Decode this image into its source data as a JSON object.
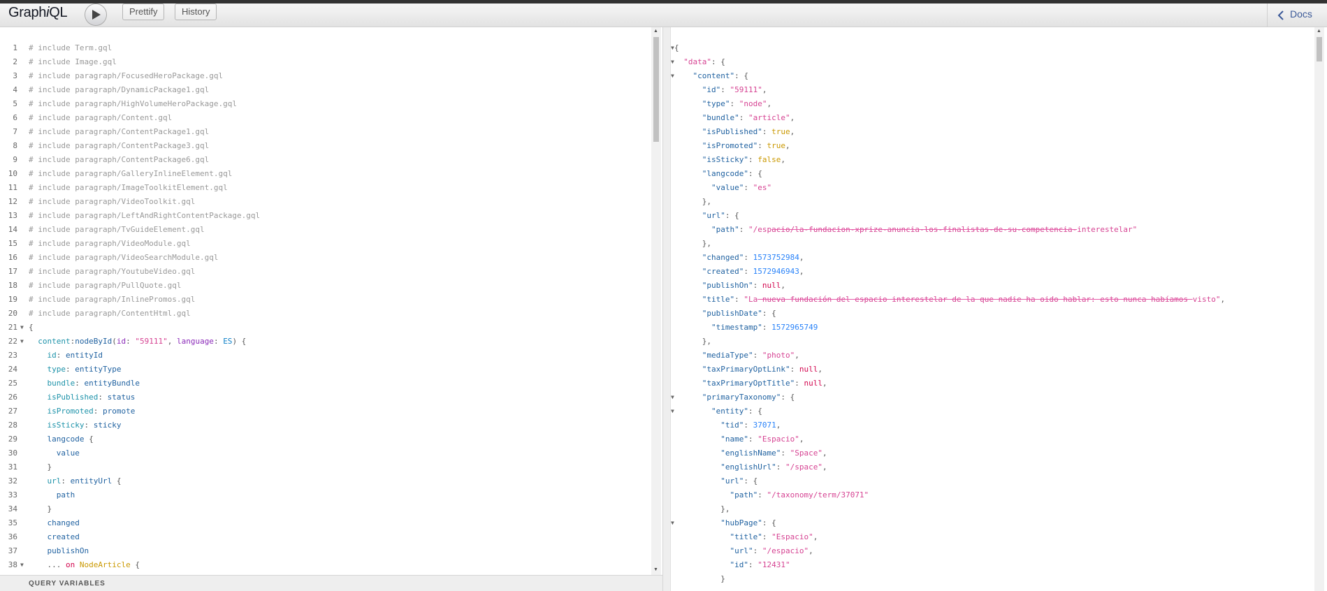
{
  "toolbar": {
    "title_prefix": "Graph",
    "title_italic": "i",
    "title_suffix": "QL",
    "run_label": "Execute Query",
    "prettify_label": "Prettify",
    "history_label": "History",
    "docs_label": "Docs"
  },
  "query_variables_label": "QUERY VARIABLES",
  "editor_lines": [
    {
      "n": "1",
      "fold": "",
      "tokens": [
        [
          "c-comment",
          "# include Term.gql"
        ]
      ]
    },
    {
      "n": "2",
      "fold": "",
      "tokens": [
        [
          "c-comment",
          "# include Image.gql"
        ]
      ]
    },
    {
      "n": "3",
      "fold": "",
      "tokens": [
        [
          "c-comment",
          "# include paragraph/FocusedHeroPackage.gql"
        ]
      ]
    },
    {
      "n": "4",
      "fold": "",
      "tokens": [
        [
          "c-comment",
          "# include paragraph/DynamicPackage1.gql"
        ]
      ]
    },
    {
      "n": "5",
      "fold": "",
      "tokens": [
        [
          "c-comment",
          "# include paragraph/HighVolumeHeroPackage.gql"
        ]
      ]
    },
    {
      "n": "6",
      "fold": "",
      "tokens": [
        [
          "c-comment",
          "# include paragraph/Content.gql"
        ]
      ]
    },
    {
      "n": "7",
      "fold": "",
      "tokens": [
        [
          "c-comment",
          "# include paragraph/ContentPackage1.gql"
        ]
      ]
    },
    {
      "n": "8",
      "fold": "",
      "tokens": [
        [
          "c-comment",
          "# include paragraph/ContentPackage3.gql"
        ]
      ]
    },
    {
      "n": "9",
      "fold": "",
      "tokens": [
        [
          "c-comment",
          "# include paragraph/ContentPackage6.gql"
        ]
      ]
    },
    {
      "n": "10",
      "fold": "",
      "tokens": [
        [
          "c-comment",
          "# include paragraph/GalleryInlineElement.gql"
        ]
      ]
    },
    {
      "n": "11",
      "fold": "",
      "tokens": [
        [
          "c-comment",
          "# include paragraph/ImageToolkitElement.gql"
        ]
      ]
    },
    {
      "n": "12",
      "fold": "",
      "tokens": [
        [
          "c-comment",
          "# include paragraph/VideoToolkit.gql"
        ]
      ]
    },
    {
      "n": "13",
      "fold": "",
      "tokens": [
        [
          "c-comment",
          "# include paragraph/LeftAndRightContentPackage.gql"
        ]
      ]
    },
    {
      "n": "14",
      "fold": "",
      "tokens": [
        [
          "c-comment",
          "# include paragraph/TvGuideElement.gql"
        ]
      ]
    },
    {
      "n": "15",
      "fold": "",
      "tokens": [
        [
          "c-comment",
          "# include paragraph/VideoModule.gql"
        ]
      ]
    },
    {
      "n": "16",
      "fold": "",
      "tokens": [
        [
          "c-comment",
          "# include paragraph/VideoSearchModule.gql"
        ]
      ]
    },
    {
      "n": "17",
      "fold": "",
      "tokens": [
        [
          "c-comment",
          "# include paragraph/YoutubeVideo.gql"
        ]
      ]
    },
    {
      "n": "18",
      "fold": "",
      "tokens": [
        [
          "c-comment",
          "# include paragraph/PullQuote.gql"
        ]
      ]
    },
    {
      "n": "19",
      "fold": "",
      "tokens": [
        [
          "c-comment",
          "# include paragraph/InlinePromos.gql"
        ]
      ]
    },
    {
      "n": "20",
      "fold": "",
      "tokens": [
        [
          "c-comment",
          "# include paragraph/ContentHtml.gql"
        ]
      ]
    },
    {
      "n": "21",
      "fold": "▼",
      "tokens": [
        [
          "c-punct",
          "{"
        ]
      ]
    },
    {
      "n": "22",
      "fold": "▼",
      "tokens": [
        [
          "c-punct",
          "  "
        ],
        [
          "c-alias",
          "content"
        ],
        [
          "c-punct",
          ":"
        ],
        [
          "c-prop",
          "nodeById"
        ],
        [
          "c-punct",
          "("
        ],
        [
          "c-attr",
          "id"
        ],
        [
          "c-punct",
          ": "
        ],
        [
          "c-string",
          "\"59111\""
        ],
        [
          "c-punct",
          ", "
        ],
        [
          "c-attr",
          "language"
        ],
        [
          "c-punct",
          ": "
        ],
        [
          "c-enum",
          "ES"
        ],
        [
          "c-punct",
          ") {"
        ]
      ]
    },
    {
      "n": "23",
      "fold": "",
      "tokens": [
        [
          "c-punct",
          "    "
        ],
        [
          "c-alias",
          "id"
        ],
        [
          "c-punct",
          ": "
        ],
        [
          "c-prop",
          "entityId"
        ]
      ]
    },
    {
      "n": "24",
      "fold": "",
      "tokens": [
        [
          "c-punct",
          "    "
        ],
        [
          "c-alias",
          "type"
        ],
        [
          "c-punct",
          ": "
        ],
        [
          "c-prop",
          "entityType"
        ]
      ]
    },
    {
      "n": "25",
      "fold": "",
      "tokens": [
        [
          "c-punct",
          "    "
        ],
        [
          "c-alias",
          "bundle"
        ],
        [
          "c-punct",
          ": "
        ],
        [
          "c-prop",
          "entityBundle"
        ]
      ]
    },
    {
      "n": "26",
      "fold": "",
      "tokens": [
        [
          "c-punct",
          "    "
        ],
        [
          "c-alias",
          "isPublished"
        ],
        [
          "c-punct",
          ": "
        ],
        [
          "c-prop",
          "status"
        ]
      ]
    },
    {
      "n": "27",
      "fold": "",
      "tokens": [
        [
          "c-punct",
          "    "
        ],
        [
          "c-alias",
          "isPromoted"
        ],
        [
          "c-punct",
          ": "
        ],
        [
          "c-prop",
          "promote"
        ]
      ]
    },
    {
      "n": "28",
      "fold": "",
      "tokens": [
        [
          "c-punct",
          "    "
        ],
        [
          "c-alias",
          "isSticky"
        ],
        [
          "c-punct",
          ": "
        ],
        [
          "c-prop",
          "sticky"
        ]
      ]
    },
    {
      "n": "29",
      "fold": "",
      "tokens": [
        [
          "c-punct",
          "    "
        ],
        [
          "c-prop",
          "langcode"
        ],
        [
          "c-punct",
          " {"
        ]
      ]
    },
    {
      "n": "30",
      "fold": "",
      "tokens": [
        [
          "c-punct",
          "      "
        ],
        [
          "c-prop",
          "value"
        ]
      ]
    },
    {
      "n": "31",
      "fold": "",
      "tokens": [
        [
          "c-punct",
          "    }"
        ]
      ]
    },
    {
      "n": "32",
      "fold": "",
      "tokens": [
        [
          "c-punct",
          "    "
        ],
        [
          "c-alias",
          "url"
        ],
        [
          "c-punct",
          ": "
        ],
        [
          "c-prop",
          "entityUrl"
        ],
        [
          "c-punct",
          " {"
        ]
      ]
    },
    {
      "n": "33",
      "fold": "",
      "tokens": [
        [
          "c-punct",
          "      "
        ],
        [
          "c-prop",
          "path"
        ]
      ]
    },
    {
      "n": "34",
      "fold": "",
      "tokens": [
        [
          "c-punct",
          "    }"
        ]
      ]
    },
    {
      "n": "35",
      "fold": "",
      "tokens": [
        [
          "c-punct",
          "    "
        ],
        [
          "c-prop",
          "changed"
        ]
      ]
    },
    {
      "n": "36",
      "fold": "",
      "tokens": [
        [
          "c-punct",
          "    "
        ],
        [
          "c-prop",
          "created"
        ]
      ]
    },
    {
      "n": "37",
      "fold": "",
      "tokens": [
        [
          "c-punct",
          "    "
        ],
        [
          "c-prop",
          "publishOn"
        ]
      ]
    },
    {
      "n": "38",
      "fold": "▼",
      "tokens": [
        [
          "c-punct",
          "    ... "
        ],
        [
          "c-def",
          "on"
        ],
        [
          "c-punct",
          " "
        ],
        [
          "c-type",
          "NodeArticle"
        ],
        [
          "c-punct",
          " {"
        ]
      ]
    }
  ],
  "result_lines": [
    {
      "fold": "▼",
      "tokens": [
        [
          "p",
          "{"
        ]
      ]
    },
    {
      "fold": "▼",
      "tokens": [
        [
          "p",
          "  "
        ],
        [
          "j-str",
          "\"data\""
        ],
        [
          "p",
          ": {"
        ]
      ]
    },
    {
      "fold": "▼",
      "tokens": [
        [
          "p",
          "    "
        ],
        [
          "j-key",
          "\"content\""
        ],
        [
          "p",
          ": {"
        ]
      ]
    },
    {
      "fold": "",
      "tokens": [
        [
          "p",
          "      "
        ],
        [
          "j-key",
          "\"id\""
        ],
        [
          "p",
          ": "
        ],
        [
          "j-str",
          "\"59111\""
        ],
        [
          "p",
          ","
        ]
      ]
    },
    {
      "fold": "",
      "tokens": [
        [
          "p",
          "      "
        ],
        [
          "j-key",
          "\"type\""
        ],
        [
          "p",
          ": "
        ],
        [
          "j-str",
          "\"node\""
        ],
        [
          "p",
          ","
        ]
      ]
    },
    {
      "fold": "",
      "tokens": [
        [
          "p",
          "      "
        ],
        [
          "j-key",
          "\"bundle\""
        ],
        [
          "p",
          ": "
        ],
        [
          "j-str",
          "\"article\""
        ],
        [
          "p",
          ","
        ]
      ]
    },
    {
      "fold": "",
      "tokens": [
        [
          "p",
          "      "
        ],
        [
          "j-key",
          "\"isPublished\""
        ],
        [
          "p",
          ": "
        ],
        [
          "j-kw",
          "true"
        ],
        [
          "p",
          ","
        ]
      ]
    },
    {
      "fold": "",
      "tokens": [
        [
          "p",
          "      "
        ],
        [
          "j-key",
          "\"isPromoted\""
        ],
        [
          "p",
          ": "
        ],
        [
          "j-kw",
          "true"
        ],
        [
          "p",
          ","
        ]
      ]
    },
    {
      "fold": "",
      "tokens": [
        [
          "p",
          "      "
        ],
        [
          "j-key",
          "\"isSticky\""
        ],
        [
          "p",
          ": "
        ],
        [
          "j-kw",
          "false"
        ],
        [
          "p",
          ","
        ]
      ]
    },
    {
      "fold": "",
      "tokens": [
        [
          "p",
          "      "
        ],
        [
          "j-key",
          "\"langcode\""
        ],
        [
          "p",
          ": {"
        ]
      ]
    },
    {
      "fold": "",
      "tokens": [
        [
          "p",
          "        "
        ],
        [
          "j-key",
          "\"value\""
        ],
        [
          "p",
          ": "
        ],
        [
          "j-str",
          "\"es\""
        ]
      ]
    },
    {
      "fold": "",
      "tokens": [
        [
          "p",
          "      },"
        ]
      ]
    },
    {
      "fold": "",
      "tokens": [
        [
          "p",
          "      "
        ],
        [
          "j-key",
          "\"url\""
        ],
        [
          "p",
          ": {"
        ]
      ]
    },
    {
      "fold": "",
      "tokens": [
        [
          "p",
          "        "
        ],
        [
          "j-key",
          "\"path\""
        ],
        [
          "p",
          ": "
        ],
        [
          "j-str",
          "\"/esp"
        ],
        [
          "j-str redact",
          "acio/la-fundacion-xprize-anuncia-los-finalistas-de-su-competencia-"
        ],
        [
          "j-str",
          "interestelar\""
        ]
      ]
    },
    {
      "fold": "",
      "tokens": [
        [
          "p",
          "      },"
        ]
      ]
    },
    {
      "fold": "",
      "tokens": [
        [
          "p",
          "      "
        ],
        [
          "j-key",
          "\"changed\""
        ],
        [
          "p",
          ": "
        ],
        [
          "j-num",
          "1573752984"
        ],
        [
          "p",
          ","
        ]
      ]
    },
    {
      "fold": "",
      "tokens": [
        [
          "p",
          "      "
        ],
        [
          "j-key",
          "\"created\""
        ],
        [
          "p",
          ": "
        ],
        [
          "j-num",
          "1572946943"
        ],
        [
          "p",
          ","
        ]
      ]
    },
    {
      "fold": "",
      "tokens": [
        [
          "p",
          "      "
        ],
        [
          "j-key",
          "\"publishOn\""
        ],
        [
          "p",
          ": "
        ],
        [
          "j-null",
          "null"
        ],
        [
          "p",
          ","
        ]
      ]
    },
    {
      "fold": "",
      "tokens": [
        [
          "p",
          "      "
        ],
        [
          "j-key",
          "\"title\""
        ],
        [
          "p",
          ": "
        ],
        [
          "j-str",
          "\"La"
        ],
        [
          "j-str redact",
          " nueva fundación del espacio interestelar de la que nadie ha oido hablar: esto nunca habíamos "
        ],
        [
          "j-str",
          "visto\""
        ],
        [
          "p",
          ","
        ]
      ]
    },
    {
      "fold": "",
      "tokens": [
        [
          "p",
          "      "
        ],
        [
          "j-key",
          "\"publishDate\""
        ],
        [
          "p",
          ": {"
        ]
      ]
    },
    {
      "fold": "",
      "tokens": [
        [
          "p",
          "        "
        ],
        [
          "j-key",
          "\"timestamp\""
        ],
        [
          "p",
          ": "
        ],
        [
          "j-num",
          "1572965749"
        ]
      ]
    },
    {
      "fold": "",
      "tokens": [
        [
          "p",
          "      },"
        ]
      ]
    },
    {
      "fold": "",
      "tokens": [
        [
          "p",
          "      "
        ],
        [
          "j-key",
          "\"mediaType\""
        ],
        [
          "p",
          ": "
        ],
        [
          "j-str",
          "\"photo\""
        ],
        [
          "p",
          ","
        ]
      ]
    },
    {
      "fold": "",
      "tokens": [
        [
          "p",
          "      "
        ],
        [
          "j-key",
          "\"taxPrimaryOptLink\""
        ],
        [
          "p",
          ": "
        ],
        [
          "j-null",
          "null"
        ],
        [
          "p",
          ","
        ]
      ]
    },
    {
      "fold": "",
      "tokens": [
        [
          "p",
          "      "
        ],
        [
          "j-key",
          "\"taxPrimaryOptTitle\""
        ],
        [
          "p",
          ": "
        ],
        [
          "j-null",
          "null"
        ],
        [
          "p",
          ","
        ]
      ]
    },
    {
      "fold": "▼",
      "tokens": [
        [
          "p",
          "      "
        ],
        [
          "j-key",
          "\"primaryTaxonomy\""
        ],
        [
          "p",
          ": {"
        ]
      ]
    },
    {
      "fold": "▼",
      "tokens": [
        [
          "p",
          "        "
        ],
        [
          "j-key",
          "\"entity\""
        ],
        [
          "p",
          ": {"
        ]
      ]
    },
    {
      "fold": "",
      "tokens": [
        [
          "p",
          "          "
        ],
        [
          "j-key",
          "\"tid\""
        ],
        [
          "p",
          ": "
        ],
        [
          "j-num",
          "37071"
        ],
        [
          "p",
          ","
        ]
      ]
    },
    {
      "fold": "",
      "tokens": [
        [
          "p",
          "          "
        ],
        [
          "j-key",
          "\"name\""
        ],
        [
          "p",
          ": "
        ],
        [
          "j-str",
          "\"Espacio\""
        ],
        [
          "p",
          ","
        ]
      ]
    },
    {
      "fold": "",
      "tokens": [
        [
          "p",
          "          "
        ],
        [
          "j-key",
          "\"englishName\""
        ],
        [
          "p",
          ": "
        ],
        [
          "j-str",
          "\"Space\""
        ],
        [
          "p",
          ","
        ]
      ]
    },
    {
      "fold": "",
      "tokens": [
        [
          "p",
          "          "
        ],
        [
          "j-key",
          "\"englishUrl\""
        ],
        [
          "p",
          ": "
        ],
        [
          "j-str",
          "\"/space\""
        ],
        [
          "p",
          ","
        ]
      ]
    },
    {
      "fold": "",
      "tokens": [
        [
          "p",
          "          "
        ],
        [
          "j-key",
          "\"url\""
        ],
        [
          "p",
          ": {"
        ]
      ]
    },
    {
      "fold": "",
      "tokens": [
        [
          "p",
          "            "
        ],
        [
          "j-key",
          "\"path\""
        ],
        [
          "p",
          ": "
        ],
        [
          "j-str",
          "\"/taxonomy/term/37071\""
        ]
      ]
    },
    {
      "fold": "",
      "tokens": [
        [
          "p",
          "          },"
        ]
      ]
    },
    {
      "fold": "▼",
      "tokens": [
        [
          "p",
          "          "
        ],
        [
          "j-key",
          "\"hubPage\""
        ],
        [
          "p",
          ": {"
        ]
      ]
    },
    {
      "fold": "",
      "tokens": [
        [
          "p",
          "            "
        ],
        [
          "j-key",
          "\"title\""
        ],
        [
          "p",
          ": "
        ],
        [
          "j-str",
          "\"Espacio\""
        ],
        [
          "p",
          ","
        ]
      ]
    },
    {
      "fold": "",
      "tokens": [
        [
          "p",
          "            "
        ],
        [
          "j-key",
          "\"url\""
        ],
        [
          "p",
          ": "
        ],
        [
          "j-str",
          "\"/espacio\""
        ],
        [
          "p",
          ","
        ]
      ]
    },
    {
      "fold": "",
      "tokens": [
        [
          "p",
          "            "
        ],
        [
          "j-key",
          "\"id\""
        ],
        [
          "p",
          ": "
        ],
        [
          "j-str",
          "\"12431\""
        ]
      ]
    },
    {
      "fold": "",
      "tokens": [
        [
          "p",
          "          }"
        ]
      ]
    }
  ]
}
